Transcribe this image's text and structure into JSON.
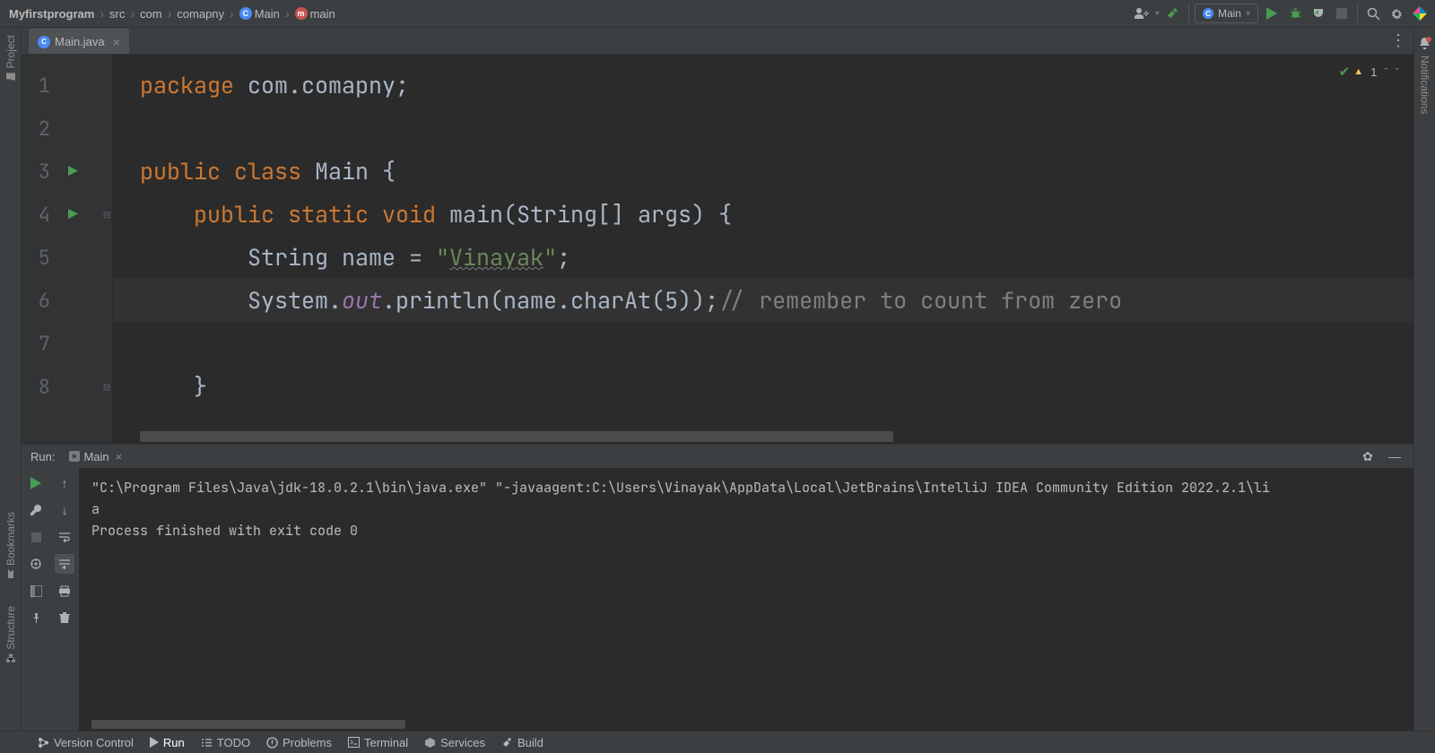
{
  "breadcrumbs": {
    "items": [
      "Myfirstprogram",
      "src",
      "com",
      "comapny",
      "Main",
      "main"
    ]
  },
  "toolbar": {
    "run_config_label": "Main"
  },
  "leftRail": {
    "project": "Project",
    "bookmarks": "Bookmarks",
    "structure": "Structure"
  },
  "rightRail": {
    "notifications": "Notifications"
  },
  "tab": {
    "filename": "Main.java"
  },
  "analysis": {
    "count": "1"
  },
  "code": {
    "lines": [
      {
        "num": "1",
        "tokens": [
          {
            "t": "package ",
            "c": "kw"
          },
          {
            "t": "com.comapny",
            "c": "txt"
          },
          {
            "t": ";",
            "c": "sym"
          }
        ]
      },
      {
        "num": "2",
        "tokens": []
      },
      {
        "num": "3",
        "runArrow": true,
        "tokens": [
          {
            "t": "public class ",
            "c": "kw"
          },
          {
            "t": "Main ",
            "c": "txt"
          },
          {
            "t": "{",
            "c": "sym"
          }
        ]
      },
      {
        "num": "4",
        "runArrow": true,
        "fold": "open",
        "indent": 1,
        "tokens": [
          {
            "t": "public static void ",
            "c": "kw"
          },
          {
            "t": "main",
            "c": "fn"
          },
          {
            "t": "(String[] args) {",
            "c": "sym"
          }
        ]
      },
      {
        "num": "5",
        "indent": 2,
        "tokens": [
          {
            "t": "String name = ",
            "c": "txt"
          },
          {
            "t": "\"",
            "c": "str"
          },
          {
            "t": "Vinayak",
            "c": "str underline-wavy"
          },
          {
            "t": "\"",
            "c": "str"
          },
          {
            "t": ";",
            "c": "sym"
          }
        ]
      },
      {
        "num": "6",
        "hl": true,
        "indent": 2,
        "tokens": [
          {
            "t": "System.",
            "c": "txt"
          },
          {
            "t": "out",
            "c": "static-f"
          },
          {
            "t": ".println(name.charAt(",
            "c": "txt"
          },
          {
            "t": "5",
            "c": "txt"
          },
          {
            "t": "));",
            "c": "sym"
          },
          {
            "t": "// remember to count from zero",
            "c": "cmt"
          }
        ]
      },
      {
        "num": "7",
        "tokens": []
      },
      {
        "num": "8",
        "fold": "close",
        "indent": 1,
        "tokens": [
          {
            "t": "}",
            "c": "sym"
          }
        ]
      }
    ]
  },
  "runPanel": {
    "title": "Run:",
    "tab": "Main",
    "console_line1": "\"C:\\Program Files\\Java\\jdk-18.0.2.1\\bin\\java.exe\" \"-javaagent:C:\\Users\\Vinayak\\AppData\\Local\\JetBrains\\IntelliJ IDEA Community Edition 2022.2.1\\li",
    "console_line2": "a",
    "console_line3": "",
    "console_line4": "Process finished with exit code 0"
  },
  "bottomBar": {
    "version_control": "Version Control",
    "run": "Run",
    "todo": "TODO",
    "problems": "Problems",
    "terminal": "Terminal",
    "services": "Services",
    "build": "Build"
  }
}
